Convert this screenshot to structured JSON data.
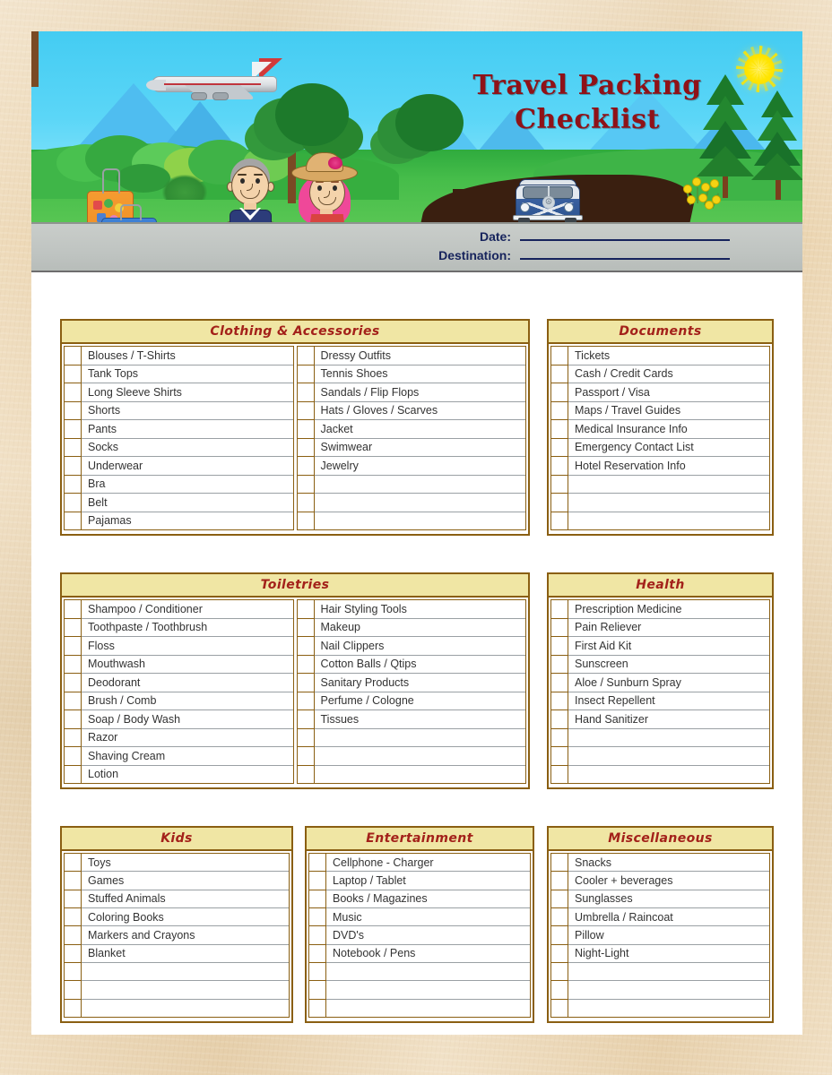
{
  "banner": {
    "title_line1": "Travel Packing",
    "title_line2": "Checklist",
    "title_color": "#8f1218",
    "sky_color": "#5bd6f7",
    "grass_color": "#46bd4a",
    "pavement_color": "#c2c7c4",
    "icons": {
      "airplane": "airplane-icon",
      "sun": "sun-icon",
      "vw_bus": "vw-bus-icon",
      "suitcase_orange": "orange-suitcase-icon",
      "suitcase_blue": "blue-suitcase-icon",
      "man": "traveler-man-illustration",
      "woman": "traveler-woman-illustration",
      "basket": "picnic-basket-icon",
      "trees": "tree-illustration",
      "flowers": "yellow-flowers-illustration",
      "mountains": "mountain-illustration"
    }
  },
  "form": {
    "date_label": "Date:",
    "date_value": "",
    "date_placeholder": "",
    "destination_label": "Destination:",
    "destination_value": "",
    "destination_placeholder": "",
    "label_color": "#16235c"
  },
  "theme": {
    "header_band": "#f0e6a4",
    "border": "#8a5f12",
    "section_title": "#a3211a",
    "item_text": "#333333",
    "row_rule": "#9aa0a4",
    "page": "#ffffff",
    "backdrop": "#e9cfa4"
  },
  "sections": [
    {
      "id": "clothing",
      "title": "Clothing & Accessories",
      "rows": 10,
      "columns": [
        [
          "Blouses / T-Shirts",
          "Tank Tops",
          "Long Sleeve Shirts",
          "Shorts",
          "Pants",
          "Socks",
          "Underwear",
          "Bra",
          "Belt",
          "Pajamas"
        ],
        [
          "Dressy Outfits",
          "Tennis Shoes",
          "Sandals / Flip Flops",
          "Hats / Gloves / Scarves",
          "Jacket",
          "Swimwear",
          "Jewelry",
          "",
          "",
          ""
        ]
      ]
    },
    {
      "id": "documents",
      "title": "Documents",
      "rows": 10,
      "columns": [
        [
          "Tickets",
          "Cash / Credit Cards",
          "Passport / Visa",
          "Maps / Travel Guides",
          "Medical Insurance Info",
          "Emergency Contact List",
          "Hotel Reservation Info",
          "",
          "",
          ""
        ]
      ]
    },
    {
      "id": "toiletries",
      "title": "Toiletries",
      "rows": 10,
      "columns": [
        [
          "Shampoo / Conditioner",
          "Toothpaste / Toothbrush",
          "Floss",
          "Mouthwash",
          "Deodorant",
          "Brush / Comb",
          "Soap / Body Wash",
          "Razor",
          "Shaving Cream",
          "Lotion"
        ],
        [
          "Hair Styling Tools",
          "Makeup",
          "Nail Clippers",
          "Cotton Balls / Qtips",
          "Sanitary Products",
          "Perfume / Cologne",
          "Tissues",
          "",
          "",
          ""
        ]
      ]
    },
    {
      "id": "health",
      "title": "Health",
      "rows": 10,
      "columns": [
        [
          "Prescription Medicine",
          "Pain Reliever",
          "First Aid Kit",
          "Sunscreen",
          "Aloe / Sunburn Spray",
          "Insect Repellent",
          "Hand Sanitizer",
          "",
          "",
          ""
        ]
      ]
    },
    {
      "id": "kids",
      "title": "Kids",
      "rows": 9,
      "columns": [
        [
          "Toys",
          "Games",
          "Stuffed Animals",
          "Coloring Books",
          "Markers and Crayons",
          "Blanket",
          "",
          "",
          ""
        ]
      ]
    },
    {
      "id": "entertainment",
      "title": "Entertainment",
      "rows": 9,
      "columns": [
        [
          "Cellphone - Charger",
          "Laptop / Tablet",
          "Books / Magazines",
          "Music",
          "DVD's",
          "Notebook / Pens",
          "",
          "",
          ""
        ]
      ]
    },
    {
      "id": "misc",
      "title": "Miscellaneous",
      "rows": 9,
      "columns": [
        [
          "Snacks",
          "Cooler + beverages",
          "Sunglasses",
          "Umbrella / Raincoat",
          "Pillow",
          "Night-Light",
          "",
          "",
          ""
        ]
      ]
    }
  ]
}
